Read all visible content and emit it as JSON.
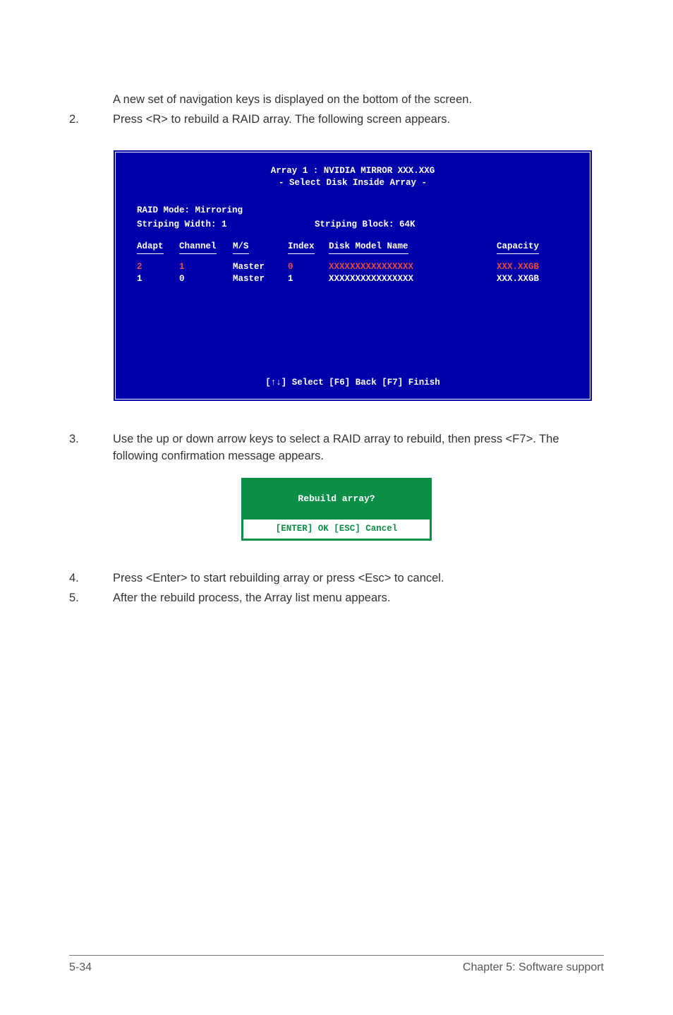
{
  "intro": "A new set of  navigation keys is displayed on the bottom of the screen.",
  "step2_num": "2.",
  "step2_text": "Press <R> to rebuild a RAID array. The following screen appears.",
  "bios": {
    "title1": "Array 1 : NVIDIA MIRROR  XXX.XXG",
    "title2": "- Select Disk Inside Array -",
    "raid_mode_label": "RAID Mode:",
    "raid_mode_value": "Mirroring",
    "striping_width_label": "Striping Width:",
    "striping_width_value": "1",
    "striping_block_label": "Striping Block:",
    "striping_block_value": "64K",
    "headers": {
      "adapt": "Adapt",
      "channel": "Channel",
      "ms": "M/S",
      "index": "Index",
      "model": "Disk Model Name",
      "capacity": "Capacity"
    },
    "rows": [
      {
        "adapt": "2",
        "channel": "1",
        "ms": "Master",
        "index": "0",
        "model": "XXXXXXXXXXXXXXXX",
        "cap": "XXX.XXGB",
        "red": true
      },
      {
        "adapt": "1",
        "channel": "0",
        "ms": "Master",
        "index": "1",
        "model": "XXXXXXXXXXXXXXXX",
        "cap": "XXX.XXGB",
        "red": false
      }
    ],
    "footer": "[↑↓] Select [F6] Back  [F7] Finish"
  },
  "step3_num": "3.",
  "step3_text": "Use the up or down arrow keys to select a RAID array to rebuild, then press <F7>. The following confirmation message appears.",
  "dialog": {
    "title": "Rebuild array?",
    "buttons": "[ENTER] OK   [ESC] Cancel"
  },
  "step4_num": "4.",
  "step4_text": "Press <Enter> to start rebuilding array or press <Esc> to cancel.",
  "step5_num": "5.",
  "step5_text": "After the rebuild process, the Array list menu appears.",
  "footer_left": "5-34",
  "footer_right": "Chapter 5: Software support"
}
